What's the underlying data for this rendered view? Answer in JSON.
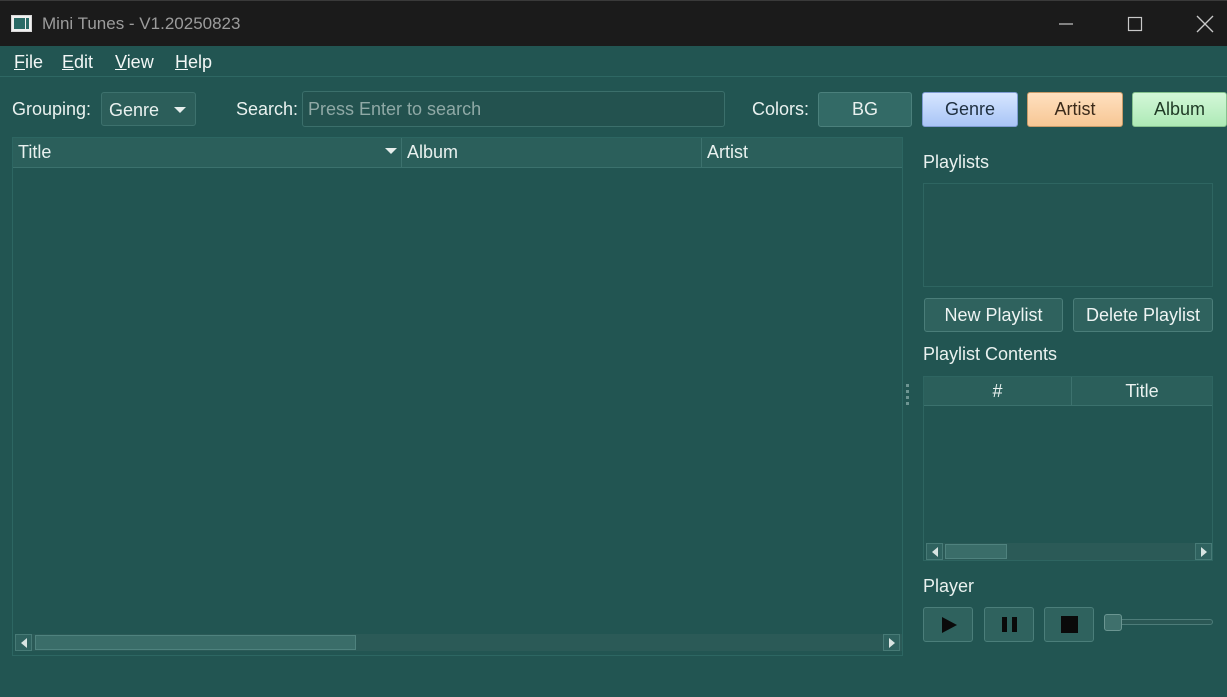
{
  "window": {
    "title": "Mini Tunes - V1.20250823"
  },
  "menu": {
    "file": "File",
    "edit": "Edit",
    "view": "View",
    "help": "Help"
  },
  "toolbar": {
    "grouping_label": "Grouping:",
    "grouping_value": "Genre",
    "search_label": "Search:",
    "search_placeholder": "Press Enter to search",
    "search_value": "",
    "colors_label": "Colors:",
    "color_buttons": [
      "BG",
      "Genre",
      "Artist",
      "Album"
    ]
  },
  "library": {
    "columns": [
      "Title",
      "Album",
      "Artist"
    ],
    "sort_column": "Title",
    "rows": []
  },
  "playlists": {
    "label": "Playlists",
    "items": [],
    "new_button": "New Playlist",
    "delete_button": "Delete Playlist",
    "contents_label": "Playlist Contents",
    "contents_columns": [
      "#",
      "Title"
    ],
    "contents_rows": []
  },
  "player": {
    "label": "Player",
    "volume_fraction": 0.0
  },
  "icons": {
    "app": "app-icon",
    "minimize": "minimize-icon",
    "maximize": "maximize-icon",
    "close": "close-icon",
    "play": "play-icon",
    "pause": "pause-icon",
    "stop": "stop-icon"
  },
  "colors": {
    "background": "#225552",
    "genre_button": "#bcd4ff",
    "artist_button": "#fbd3a9",
    "album_button": "#bff0c6"
  }
}
